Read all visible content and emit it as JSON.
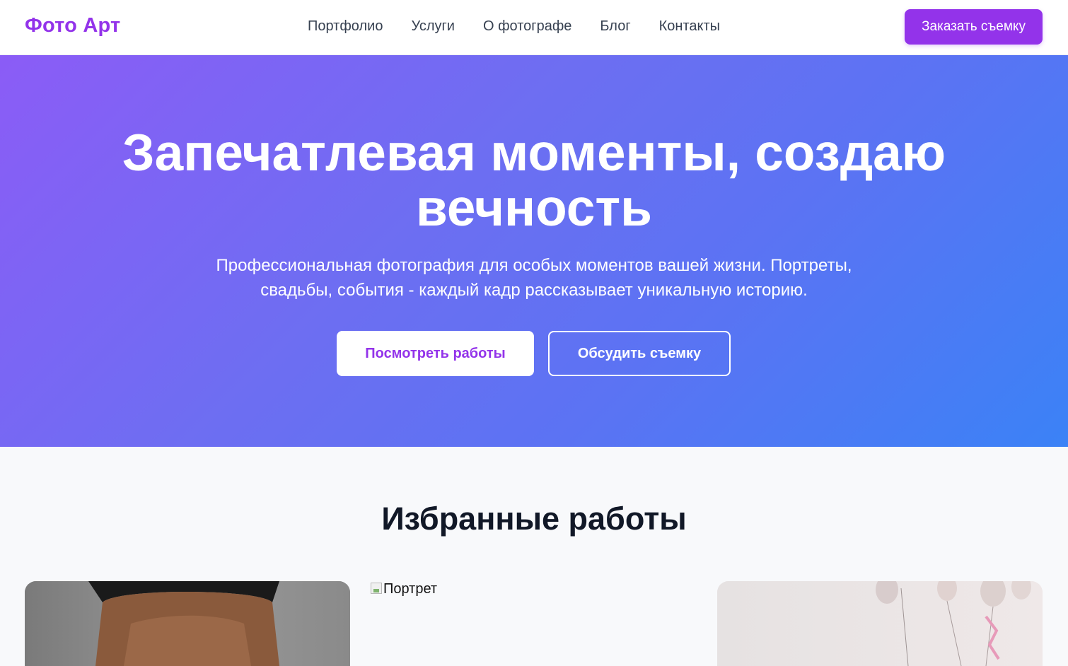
{
  "brand": {
    "logo": "Фото Арт",
    "accent": "#9333ea"
  },
  "nav": {
    "items": [
      {
        "label": "Портфолио"
      },
      {
        "label": "Услуги"
      },
      {
        "label": "О фотографе"
      },
      {
        "label": "Блог"
      },
      {
        "label": "Контакты"
      }
    ],
    "cta_label": "Заказать съемку"
  },
  "hero": {
    "title": "Запечатлевая моменты, создаю вечность",
    "subtitle": "Профессиональная фотография для особых моментов вашей жизни. Портреты, свадьбы, события - каждый кадр рассказывает уникальную историю.",
    "primary_button": "Посмотреть работы",
    "secondary_button": "Обсудить съемку",
    "gradient_start": "#8b5cf6",
    "gradient_end": "#3b82f6"
  },
  "works": {
    "title": "Избранные работы",
    "items": [
      {
        "alt": "",
        "kind": "portrait-photo"
      },
      {
        "alt": "Портрет",
        "kind": "broken-image"
      },
      {
        "alt": "",
        "kind": "balloons-photo"
      }
    ]
  }
}
